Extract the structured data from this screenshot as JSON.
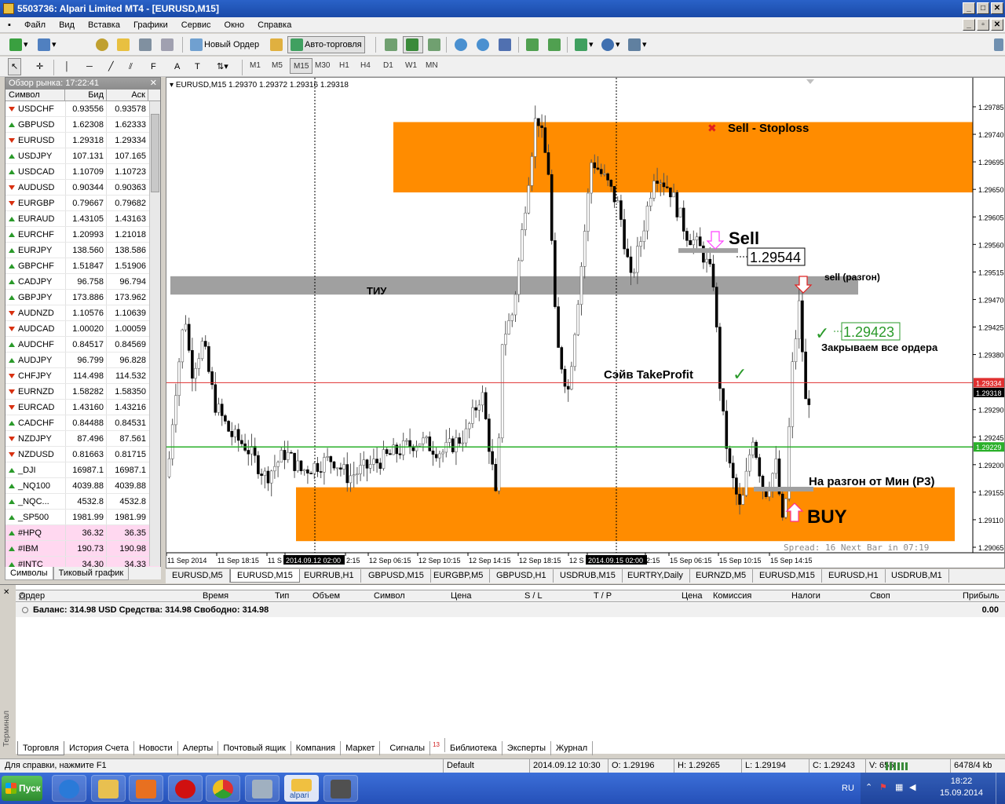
{
  "window": {
    "title": "5503736: Alpari Limited MT4 - [EURUSD,M15]"
  },
  "menu": [
    "Файл",
    "Вид",
    "Вставка",
    "Графики",
    "Сервис",
    "Окно",
    "Справка"
  ],
  "toolbar": {
    "new_order": "Новый Ордер",
    "autotrading": "Авто-торговля"
  },
  "timeframes": [
    "M1",
    "M5",
    "M15",
    "M30",
    "H1",
    "H4",
    "D1",
    "W1",
    "MN"
  ],
  "active_timeframe": "M15",
  "market_watch": {
    "title": "Обзор рынка: 17:22:41",
    "headers": {
      "symbol": "Символ",
      "bid": "Бид",
      "ask": "Аск"
    },
    "rows": [
      {
        "s": "USDCHF",
        "b": "0.93556",
        "a": "0.93578",
        "d": "down"
      },
      {
        "s": "GBPUSD",
        "b": "1.62308",
        "a": "1.62333",
        "d": "up"
      },
      {
        "s": "EURUSD",
        "b": "1.29318",
        "a": "1.29334",
        "d": "down"
      },
      {
        "s": "USDJPY",
        "b": "107.131",
        "a": "107.165",
        "d": "up"
      },
      {
        "s": "USDCAD",
        "b": "1.10709",
        "a": "1.10723",
        "d": "up"
      },
      {
        "s": "AUDUSD",
        "b": "0.90344",
        "a": "0.90363",
        "d": "down"
      },
      {
        "s": "EURGBP",
        "b": "0.79667",
        "a": "0.79682",
        "d": "down"
      },
      {
        "s": "EURAUD",
        "b": "1.43105",
        "a": "1.43163",
        "d": "up"
      },
      {
        "s": "EURCHF",
        "b": "1.20993",
        "a": "1.21018",
        "d": "up"
      },
      {
        "s": "EURJPY",
        "b": "138.560",
        "a": "138.586",
        "d": "up"
      },
      {
        "s": "GBPCHF",
        "b": "1.51847",
        "a": "1.51906",
        "d": "up"
      },
      {
        "s": "CADJPY",
        "b": "96.758",
        "a": "96.794",
        "d": "up"
      },
      {
        "s": "GBPJPY",
        "b": "173.886",
        "a": "173.962",
        "d": "up"
      },
      {
        "s": "AUDNZD",
        "b": "1.10576",
        "a": "1.10639",
        "d": "down"
      },
      {
        "s": "AUDCAD",
        "b": "1.00020",
        "a": "1.00059",
        "d": "down"
      },
      {
        "s": "AUDCHF",
        "b": "0.84517",
        "a": "0.84569",
        "d": "up"
      },
      {
        "s": "AUDJPY",
        "b": "96.799",
        "a": "96.828",
        "d": "up"
      },
      {
        "s": "CHFJPY",
        "b": "114.498",
        "a": "114.532",
        "d": "down"
      },
      {
        "s": "EURNZD",
        "b": "1.58282",
        "a": "1.58350",
        "d": "down"
      },
      {
        "s": "EURCAD",
        "b": "1.43160",
        "a": "1.43216",
        "d": "down"
      },
      {
        "s": "CADCHF",
        "b": "0.84488",
        "a": "0.84531",
        "d": "up"
      },
      {
        "s": "NZDJPY",
        "b": "87.496",
        "a": "87.561",
        "d": "down"
      },
      {
        "s": "NZDUSD",
        "b": "0.81663",
        "a": "0.81715",
        "d": "down"
      },
      {
        "s": "_DJI",
        "b": "16987.1",
        "a": "16987.1",
        "d": "up"
      },
      {
        "s": "_NQ100",
        "b": "4039.88",
        "a": "4039.88",
        "d": "up"
      },
      {
        "s": "_NQC...",
        "b": "4532.8",
        "a": "4532.8",
        "d": "up"
      },
      {
        "s": "_SP500",
        "b": "1981.99",
        "a": "1981.99",
        "d": "up"
      },
      {
        "s": "#HPQ",
        "b": "36.32",
        "a": "36.35",
        "d": "up",
        "hl": true
      },
      {
        "s": "#IBM",
        "b": "190.73",
        "a": "190.98",
        "d": "up",
        "hl": true
      },
      {
        "s": "#INTC",
        "b": "34.30",
        "a": "34.33",
        "d": "up",
        "hl": true
      }
    ],
    "tabs": [
      "Символы",
      "Тиковый график"
    ]
  },
  "chart": {
    "header": "EURUSD,M15  1.29370 1.29372 1.29316 1.29318",
    "price_ticks": [
      "1.29785",
      "1.29740",
      "1.29695",
      "1.29650",
      "1.29605",
      "1.29560",
      "1.29515",
      "1.29470",
      "1.29425",
      "1.29380",
      "1.29290",
      "1.29245",
      "1.29200",
      "1.29155",
      "1.29110",
      "1.29065"
    ],
    "ask_label": "1.29334",
    "bid_label": "1.29318",
    "green_label": "1.29229",
    "time_ticks": [
      "11 Sep 2014",
      "11 Sep 18:15",
      "11 S",
      "2014.09.12 02:00",
      "2:15",
      "12 Sep 06:15",
      "12 Sep 10:15",
      "12 Sep 14:15",
      "12 Sep 18:15",
      "12 S",
      "2014.09.15 02:00",
      "2:15",
      "15 Sep 06:15",
      "15 Sep 10:15",
      "15 Sep 14:15"
    ],
    "annotations": {
      "sell_stoploss": "Sell - Stoploss",
      "sell": "Sell",
      "sell_price": "1.29544",
      "tiu": "ТИУ",
      "sell_razgon": "sell (разгон)",
      "close_price": "1.29423",
      "close_all": "Закрываем все ордера",
      "save_tp": "Сэйв TakeProfit",
      "razgon_min": "На разгон от Мин (Р3)",
      "buy": "BUY",
      "spread": "Spread: 16  Next Bar in 07:19"
    },
    "colors": {
      "zone": "#ff8c00",
      "gray": "#a0a0a0",
      "ask": "#e03030",
      "green": "#2ab02a"
    }
  },
  "chart_tabs": [
    "EURUSD,M5",
    "EURUSD,M15",
    "EURRUB,H1",
    "GBPUSD,M15",
    "EURGBP,M5",
    "GBPUSD,H1",
    "USDRUB,M15",
    "EURTRY,Daily",
    "EURNZD,M5",
    "EURUSD,M15",
    "EURUSD,H1",
    "USDRUB,M1"
  ],
  "active_chart_tab": 1,
  "terminal": {
    "headers": [
      "Ордер",
      "Время",
      "Тип",
      "Объем",
      "Символ",
      "Цена",
      "S / L",
      "T / P",
      "Цена",
      "Комиссия",
      "Налоги",
      "Своп",
      "Прибыль"
    ],
    "balance": "Баланс: 314.98 USD  Средства: 314.98  Свободно: 314.98",
    "profit": "0.00",
    "side_label": "Терминал",
    "tabs": [
      "Торговля",
      "История Счета",
      "Новости",
      "Алерты",
      "Почтовый ящик",
      "Компания",
      "Маркет",
      "Сигналы",
      "Библиотека",
      "Эксперты",
      "Журнал"
    ],
    "signals_badge": "13"
  },
  "status": {
    "help": "Для справки, нажмите F1",
    "profile": "Default",
    "datetime": "2014.09.12 10:30",
    "open": "O: 1.29196",
    "high": "H: 1.29265",
    "low": "L: 1.29194",
    "close": "C: 1.29243",
    "volume": "V: 655",
    "traffic": "6478/4 kb"
  },
  "taskbar": {
    "start": "Пуск",
    "lang": "RU",
    "time": "18:22",
    "date": "15.09.2014",
    "alpari": "alpari"
  }
}
